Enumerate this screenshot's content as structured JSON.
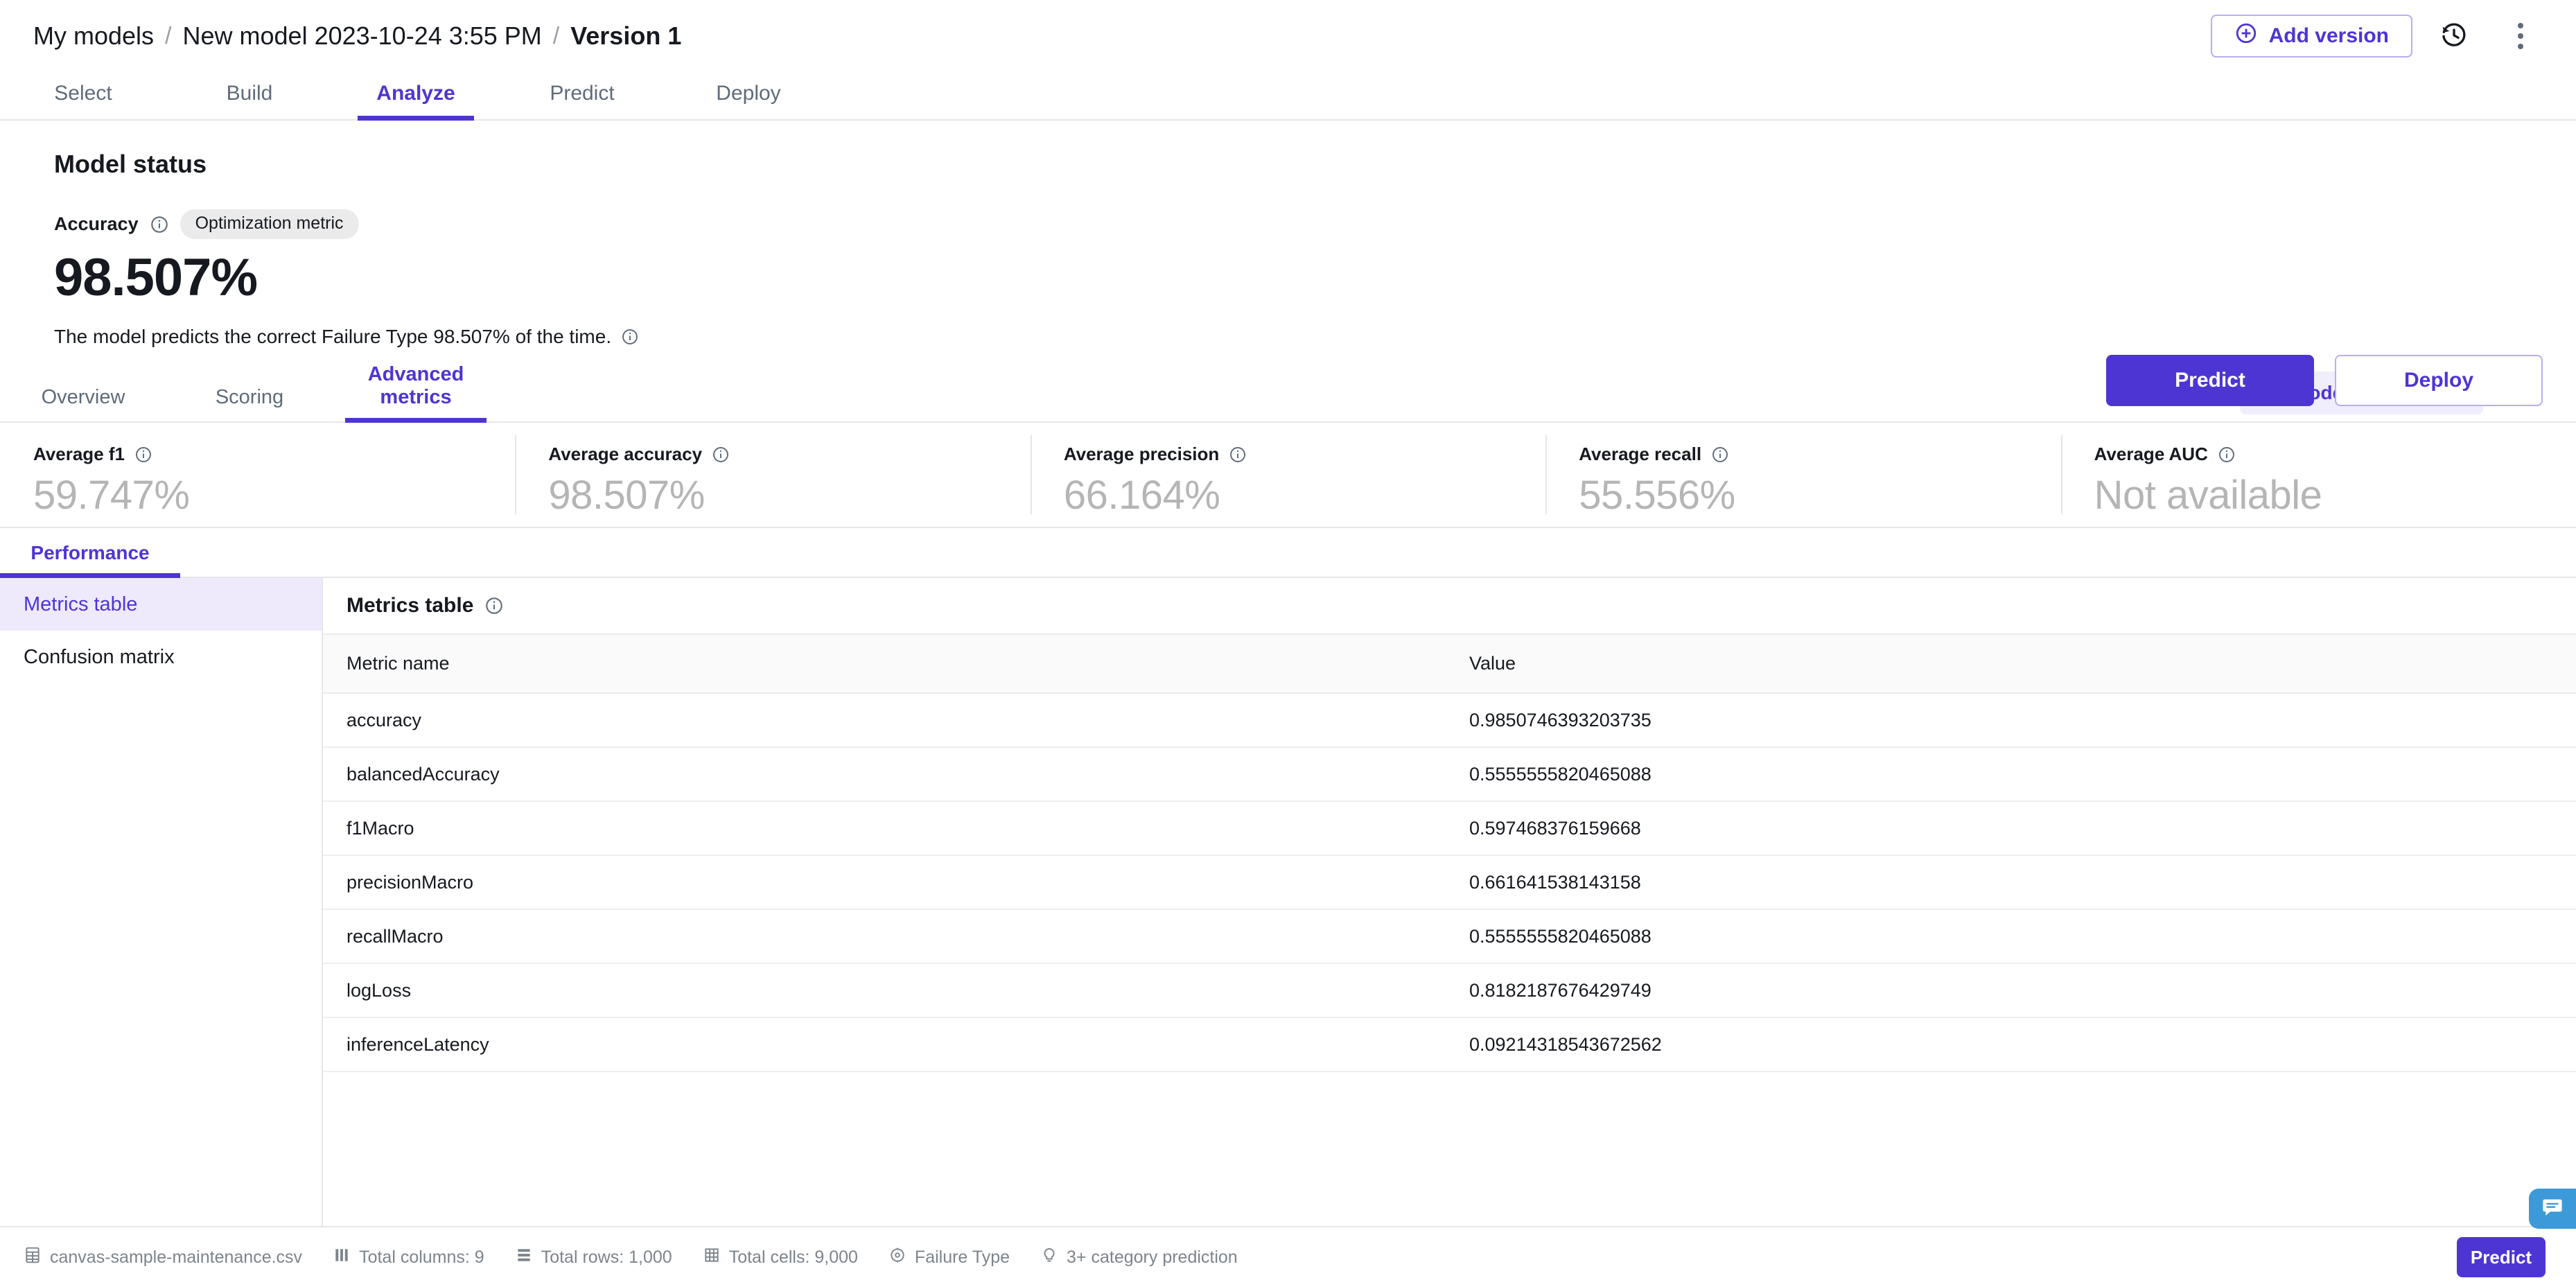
{
  "breadcrumb": {
    "items": [
      {
        "label": "My models"
      },
      {
        "label": "New model 2023-10-24 3:55 PM"
      },
      {
        "label": "Version 1"
      }
    ],
    "separator": "/"
  },
  "topbar": {
    "add_version_label": "Add version",
    "history_icon": "history-icon",
    "more_icon": "kebab-menu-icon"
  },
  "primary_tabs": [
    {
      "label": "Select",
      "active": false
    },
    {
      "label": "Build",
      "active": false
    },
    {
      "label": "Analyze",
      "active": true
    },
    {
      "label": "Predict",
      "active": false
    },
    {
      "label": "Deploy",
      "active": false
    }
  ],
  "model_status": {
    "title": "Model status",
    "metric_label": "Accuracy",
    "badge": "Optimization metric",
    "value": "98.507%",
    "description": "The model predicts the correct Failure Type 98.507% of the time.",
    "predict_button": "Predict",
    "deploy_button": "Deploy"
  },
  "secondary_tabs": [
    {
      "label": "Overview",
      "active": false
    },
    {
      "label": "Scoring",
      "active": false
    },
    {
      "label": "Advanced metrics",
      "active": true
    }
  ],
  "leaderboard": {
    "label": "Model leaderboard",
    "icon": "bar-chart-icon",
    "collapse_icon": "chevron-double-up-icon"
  },
  "metric_cards": [
    {
      "label": "Average f1",
      "value": "59.747%"
    },
    {
      "label": "Average accuracy",
      "value": "98.507%"
    },
    {
      "label": "Average precision",
      "value": "66.164%"
    },
    {
      "label": "Average recall",
      "value": "55.556%"
    },
    {
      "label": "Average AUC",
      "value": "Not available"
    }
  ],
  "performance_tab": {
    "label": "Performance"
  },
  "sidebar": {
    "items": [
      {
        "label": "Metrics table",
        "active": true
      },
      {
        "label": "Confusion matrix",
        "active": false
      }
    ]
  },
  "metrics_panel": {
    "title": "Metrics table",
    "columns": [
      "Metric name",
      "Value"
    ],
    "rows": [
      {
        "name": "accuracy",
        "value": "0.9850746393203735"
      },
      {
        "name": "balancedAccuracy",
        "value": "0.5555555820465088"
      },
      {
        "name": "f1Macro",
        "value": "0.597468376159668"
      },
      {
        "name": "precisionMacro",
        "value": "0.661641538143158"
      },
      {
        "name": "recallMacro",
        "value": "0.5555555820465088"
      },
      {
        "name": "logLoss",
        "value": "0.8182187676429749"
      },
      {
        "name": "inferenceLatency",
        "value": "0.09214318543672562"
      }
    ]
  },
  "footer": {
    "items": [
      {
        "icon": "file-csv-icon",
        "label": "canvas-sample-maintenance.csv"
      },
      {
        "icon": "columns-icon",
        "label": "Total columns: 9"
      },
      {
        "icon": "rows-icon",
        "label": "Total rows: 1,000"
      },
      {
        "icon": "cells-grid-icon",
        "label": "Total cells: 9,000"
      },
      {
        "icon": "target-icon",
        "label": "Failure Type"
      },
      {
        "icon": "lightbulb-icon",
        "label": "3+ category prediction"
      }
    ],
    "predict_button": "Predict",
    "chat_icon": "chat-bubble-icon"
  },
  "colors": {
    "accent": "#4d35d4",
    "accent_soft": "#f0edfc",
    "accent_selected": "#eeeafc",
    "chat": "#3d9ad8",
    "muted_value": "#b5b5b5"
  }
}
